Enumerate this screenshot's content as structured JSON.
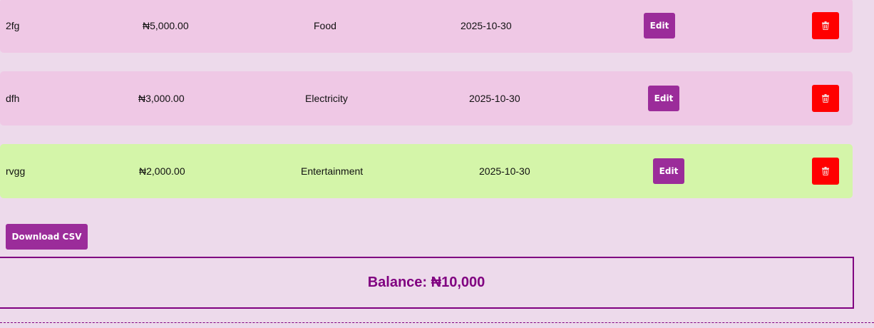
{
  "expenses": [
    {
      "title": "2fg",
      "amount": "₦5,000.00",
      "category": "Food",
      "date": "2025-10-30",
      "edit_label": "Edit",
      "delete_icon": "trash-icon"
    },
    {
      "title": "dfh",
      "amount": "₦3,000.00",
      "category": "Electricity",
      "date": "2025-10-30",
      "edit_label": "Edit",
      "delete_icon": "trash-icon"
    },
    {
      "title": "rvgg",
      "amount": "₦2,000.00",
      "category": "Entertainment",
      "date": "2025-10-30",
      "edit_label": "Edit",
      "delete_icon": "trash-icon"
    }
  ],
  "download_label": "Download CSV",
  "balance_text": "Balance: ₦10,000",
  "colors": {
    "background": "#eddaeb",
    "row_pink": "#efc8e5",
    "row_green": "#d4f5a9",
    "button_purple": "#9b2c9a",
    "delete_red": "#ff0000",
    "balance_purple": "#800080"
  }
}
